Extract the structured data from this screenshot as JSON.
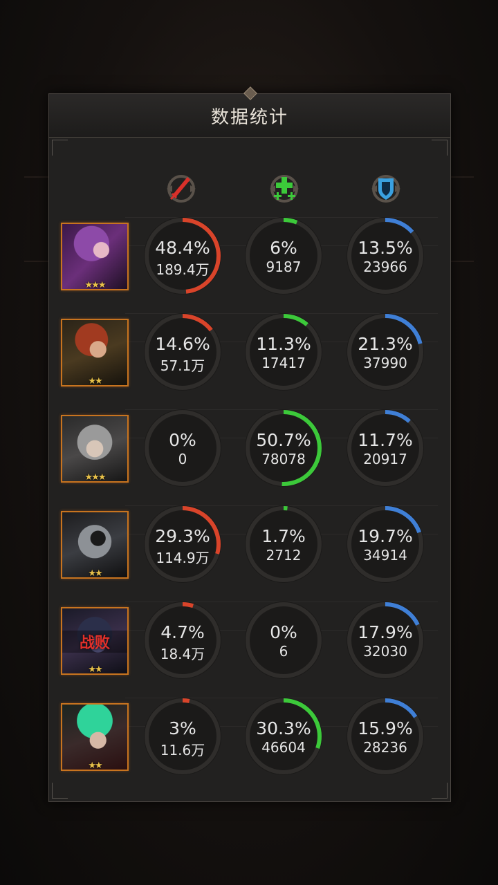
{
  "title": "数据统计",
  "colors": {
    "damage": "#d9442a",
    "heal": "#3cc93a",
    "shield": "#3f7fd6"
  },
  "stat_icons": [
    "sword-icon",
    "heal-plus-icon",
    "shield-icon"
  ],
  "heroes": [
    {
      "name": "hero-1",
      "stars": "★★★",
      "defeated": "",
      "damage": {
        "pct": "48.4%",
        "value": "189.4万",
        "fraction": 0.484
      },
      "heal": {
        "pct": "6%",
        "value": "9187",
        "fraction": 0.06
      },
      "shield": {
        "pct": "13.5%",
        "value": "23966",
        "fraction": 0.135
      }
    },
    {
      "name": "hero-2",
      "stars": "★★",
      "defeated": "",
      "damage": {
        "pct": "14.6%",
        "value": "57.1万",
        "fraction": 0.146
      },
      "heal": {
        "pct": "11.3%",
        "value": "17417",
        "fraction": 0.113
      },
      "shield": {
        "pct": "21.3%",
        "value": "37990",
        "fraction": 0.213
      }
    },
    {
      "name": "hero-3",
      "stars": "★★★",
      "defeated": "",
      "damage": {
        "pct": "0%",
        "value": "0",
        "fraction": 0
      },
      "heal": {
        "pct": "50.7%",
        "value": "78078",
        "fraction": 0.507
      },
      "shield": {
        "pct": "11.7%",
        "value": "20917",
        "fraction": 0.117
      }
    },
    {
      "name": "hero-4",
      "stars": "★★",
      "defeated": "",
      "damage": {
        "pct": "29.3%",
        "value": "114.9万",
        "fraction": 0.293
      },
      "heal": {
        "pct": "1.7%",
        "value": "2712",
        "fraction": 0.017
      },
      "shield": {
        "pct": "19.7%",
        "value": "34914",
        "fraction": 0.197
      }
    },
    {
      "name": "hero-5",
      "stars": "★★",
      "defeated": "战败",
      "damage": {
        "pct": "4.7%",
        "value": "18.4万",
        "fraction": 0.047
      },
      "heal": {
        "pct": "0%",
        "value": "6",
        "fraction": 0
      },
      "shield": {
        "pct": "17.9%",
        "value": "32030",
        "fraction": 0.179
      }
    },
    {
      "name": "hero-6",
      "stars": "★★",
      "defeated": "",
      "damage": {
        "pct": "3%",
        "value": "11.6万",
        "fraction": 0.03
      },
      "heal": {
        "pct": "30.3%",
        "value": "46604",
        "fraction": 0.303
      },
      "shield": {
        "pct": "15.9%",
        "value": "28236",
        "fraction": 0.159
      }
    }
  ]
}
